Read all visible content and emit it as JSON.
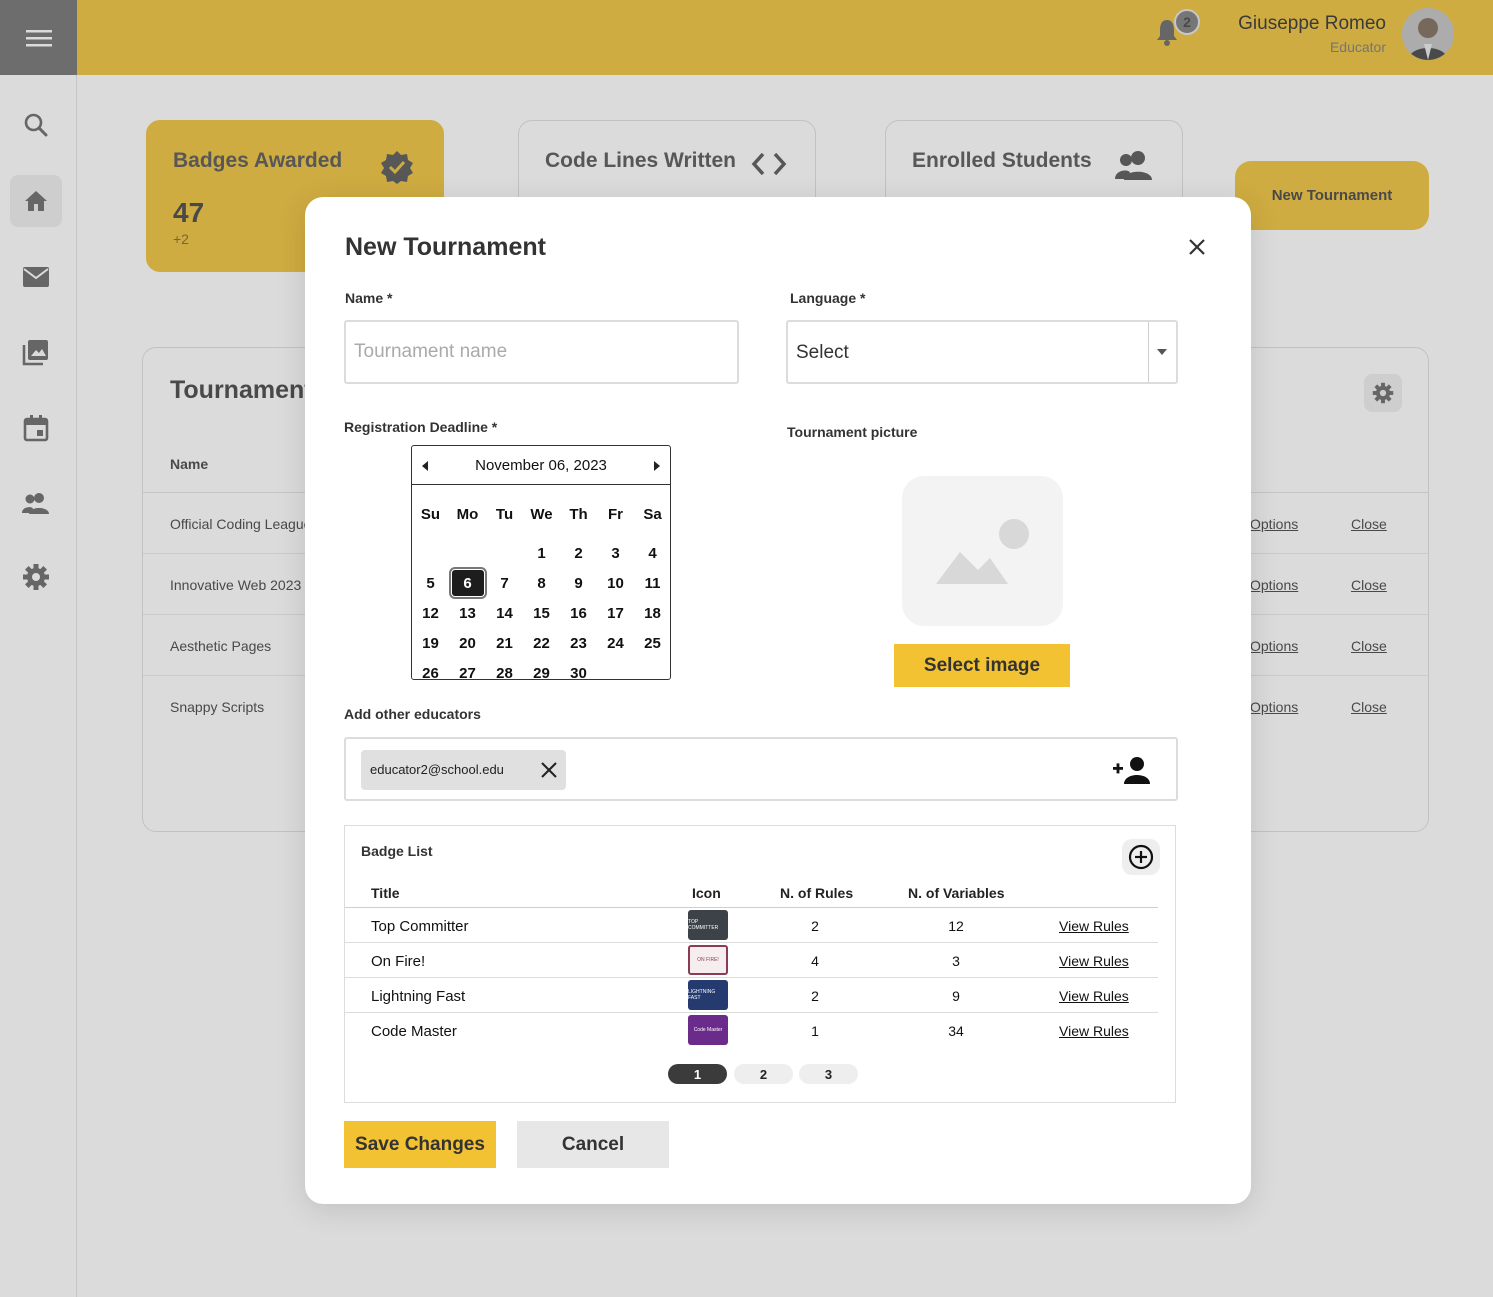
{
  "app": {
    "notifications_count": "2",
    "user_name": "Giuseppe Romeo",
    "user_role": "Educator",
    "accent_color": "#f2c94c"
  },
  "stats": {
    "badges_title": "Badges Awarded",
    "badges_value": "47",
    "badges_delta": "+2",
    "code_title": "Code Lines Written",
    "students_title": "Enrolled Students"
  },
  "header_button": "New Tournament",
  "tournaments_table": {
    "title": "Tournaments",
    "name_header": "Name",
    "rows": [
      {
        "name": "Official Coding League",
        "action1": "Options",
        "action2": "Close"
      },
      {
        "name": "Innovative Web 2023",
        "action1": "Options",
        "action2": "Close"
      },
      {
        "name": "Aesthetic Pages",
        "action1": "Options",
        "action2": "Close"
      },
      {
        "name": "Snappy Scripts",
        "action1": "Options",
        "action2": "Close"
      }
    ]
  },
  "modal": {
    "title": "New Tournament",
    "name_label": "Name *",
    "name_placeholder": "Tournament name",
    "language_label": "Language *",
    "language_value": "Select",
    "deadline_label": "Registration Deadline *",
    "picture_label": "Tournament picture",
    "select_image": "Select image",
    "educators_label": "Add other educators",
    "educator_chip": "educator2@school.edu",
    "calendar": {
      "month_label": "November 06, 2023",
      "weekdays": [
        "Su",
        "Mo",
        "Tu",
        "We",
        "Th",
        "Fr",
        "Sa"
      ],
      "weeks": [
        [
          "",
          "",
          "",
          "1",
          "2",
          "3",
          "4"
        ],
        [
          "5",
          "6",
          "7",
          "8",
          "9",
          "10",
          "11"
        ],
        [
          "12",
          "13",
          "14",
          "15",
          "16",
          "17",
          "18"
        ],
        [
          "19",
          "20",
          "21",
          "22",
          "23",
          "24",
          "25"
        ],
        [
          "26",
          "27",
          "28",
          "29",
          "30",
          "",
          ""
        ]
      ],
      "selected_day": "6"
    },
    "badge_list": {
      "title": "Badge List",
      "headers": {
        "title": "Title",
        "icon": "Icon",
        "rules": "N. of Rules",
        "variables": "N. of Variables"
      },
      "rows": [
        {
          "title": "Top Committer",
          "rules": "2",
          "variables": "12",
          "action": "View Rules",
          "icon_color": "#3d4148",
          "icon_text": "TOP COMMITTER"
        },
        {
          "title": "On Fire!",
          "rules": "4",
          "variables": "3",
          "action": "View Rules",
          "icon_color": "#f6eeee",
          "icon_text": "ON FIRE!"
        },
        {
          "title": "Lightning Fast",
          "rules": "2",
          "variables": "9",
          "action": "View Rules",
          "icon_color": "#253a6e",
          "icon_text": "LIGHTNING FAST"
        },
        {
          "title": "Code Master",
          "rules": "1",
          "variables": "34",
          "action": "View Rules",
          "icon_color": "#6a2b8a",
          "icon_text": "Code Master"
        }
      ],
      "pages": [
        "1",
        "2",
        "3"
      ],
      "active_page": "1"
    },
    "save_label": "Save Changes",
    "cancel_label": "Cancel"
  }
}
